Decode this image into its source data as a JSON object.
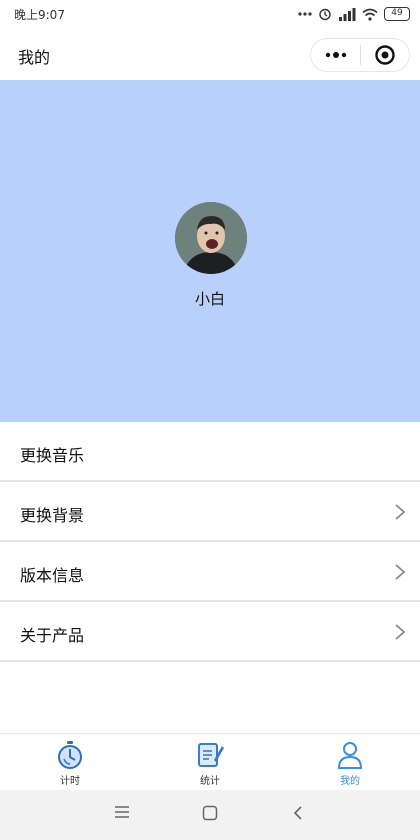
{
  "status_bar": {
    "time": "晚上9:07",
    "battery": "49"
  },
  "nav": {
    "title": "我的"
  },
  "profile": {
    "username": "小白",
    "banner_color": "#b8d0fb"
  },
  "menu": {
    "items": [
      {
        "label": "更换音乐",
        "has_arrow": false
      },
      {
        "label": "更换背景",
        "has_arrow": true
      },
      {
        "label": "版本信息",
        "has_arrow": true
      },
      {
        "label": "关于产品",
        "has_arrow": true
      }
    ]
  },
  "tab_bar": {
    "tabs": [
      {
        "label": "计时",
        "icon": "stopwatch-icon",
        "active": false
      },
      {
        "label": "统计",
        "icon": "notepad-icon",
        "active": false
      },
      {
        "label": "我的",
        "icon": "person-icon",
        "active": true
      }
    ],
    "active_color": "#3a8fd6"
  }
}
